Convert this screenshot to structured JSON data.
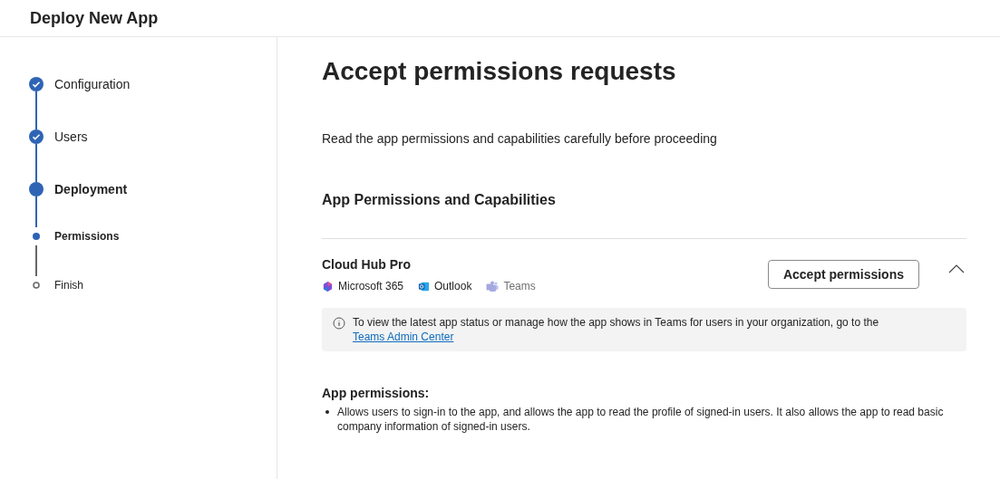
{
  "header": {
    "title": "Deploy New App"
  },
  "steps": [
    {
      "label": "Configuration",
      "kind": "completed"
    },
    {
      "label": "Users",
      "kind": "completed"
    },
    {
      "label": "Deployment",
      "kind": "current"
    },
    {
      "label": "Permissions",
      "kind": "sub_current"
    },
    {
      "label": "Finish",
      "kind": "sub_pending"
    }
  ],
  "page": {
    "title": "Accept permissions requests",
    "description": "Read the app permissions and capabilities carefully before proceeding",
    "section_title": "App Permissions and Capabilities"
  },
  "app": {
    "name": "Cloud Hub Pro",
    "expanded": true,
    "accept_button": "Accept permissions",
    "hosts": [
      {
        "label": "Microsoft 365",
        "kind": "m365",
        "disabled": false
      },
      {
        "label": "Outlook",
        "kind": "outlook",
        "disabled": false
      },
      {
        "label": "Teams",
        "kind": "teams",
        "disabled": true
      }
    ],
    "notice": {
      "text": "To view the latest app status or manage how the app shows in Teams for users in your organization, go to the ",
      "link": "Teams Admin Center"
    }
  },
  "permissions": {
    "title": "App permissions:",
    "items": [
      "Allows users to sign-in to the app, and allows the app to read the profile of signed-in users. It also allows the app to read basic company information of signed-in users."
    ]
  }
}
